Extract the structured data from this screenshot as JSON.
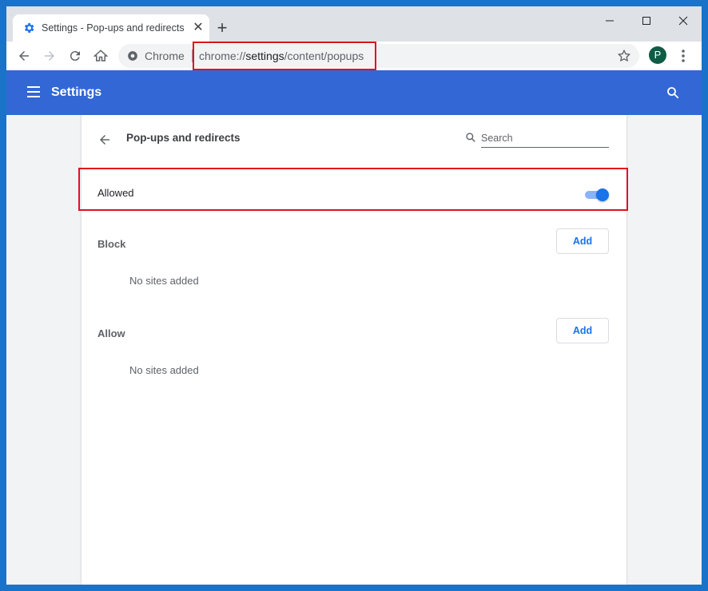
{
  "tab": {
    "title": "Settings - Pop-ups and redirects",
    "favicon": "gear-icon"
  },
  "omnibox": {
    "chip": "Chrome",
    "scheme": "chrome://",
    "host": "settings",
    "path": "/content/popups"
  },
  "profile": {
    "initial": "P"
  },
  "appbar": {
    "title": "Settings"
  },
  "subpage": {
    "title": "Pop-ups and redirects",
    "search_placeholder": "Search"
  },
  "allowed": {
    "label": "Allowed",
    "enabled": true
  },
  "block": {
    "title": "Block",
    "add_label": "Add",
    "empty": "No sites added"
  },
  "allow": {
    "title": "Allow",
    "add_label": "Add",
    "empty": "No sites added"
  },
  "colors": {
    "accent": "#1a73e8",
    "appbar": "#3367d6",
    "highlight": "#e0101e"
  }
}
